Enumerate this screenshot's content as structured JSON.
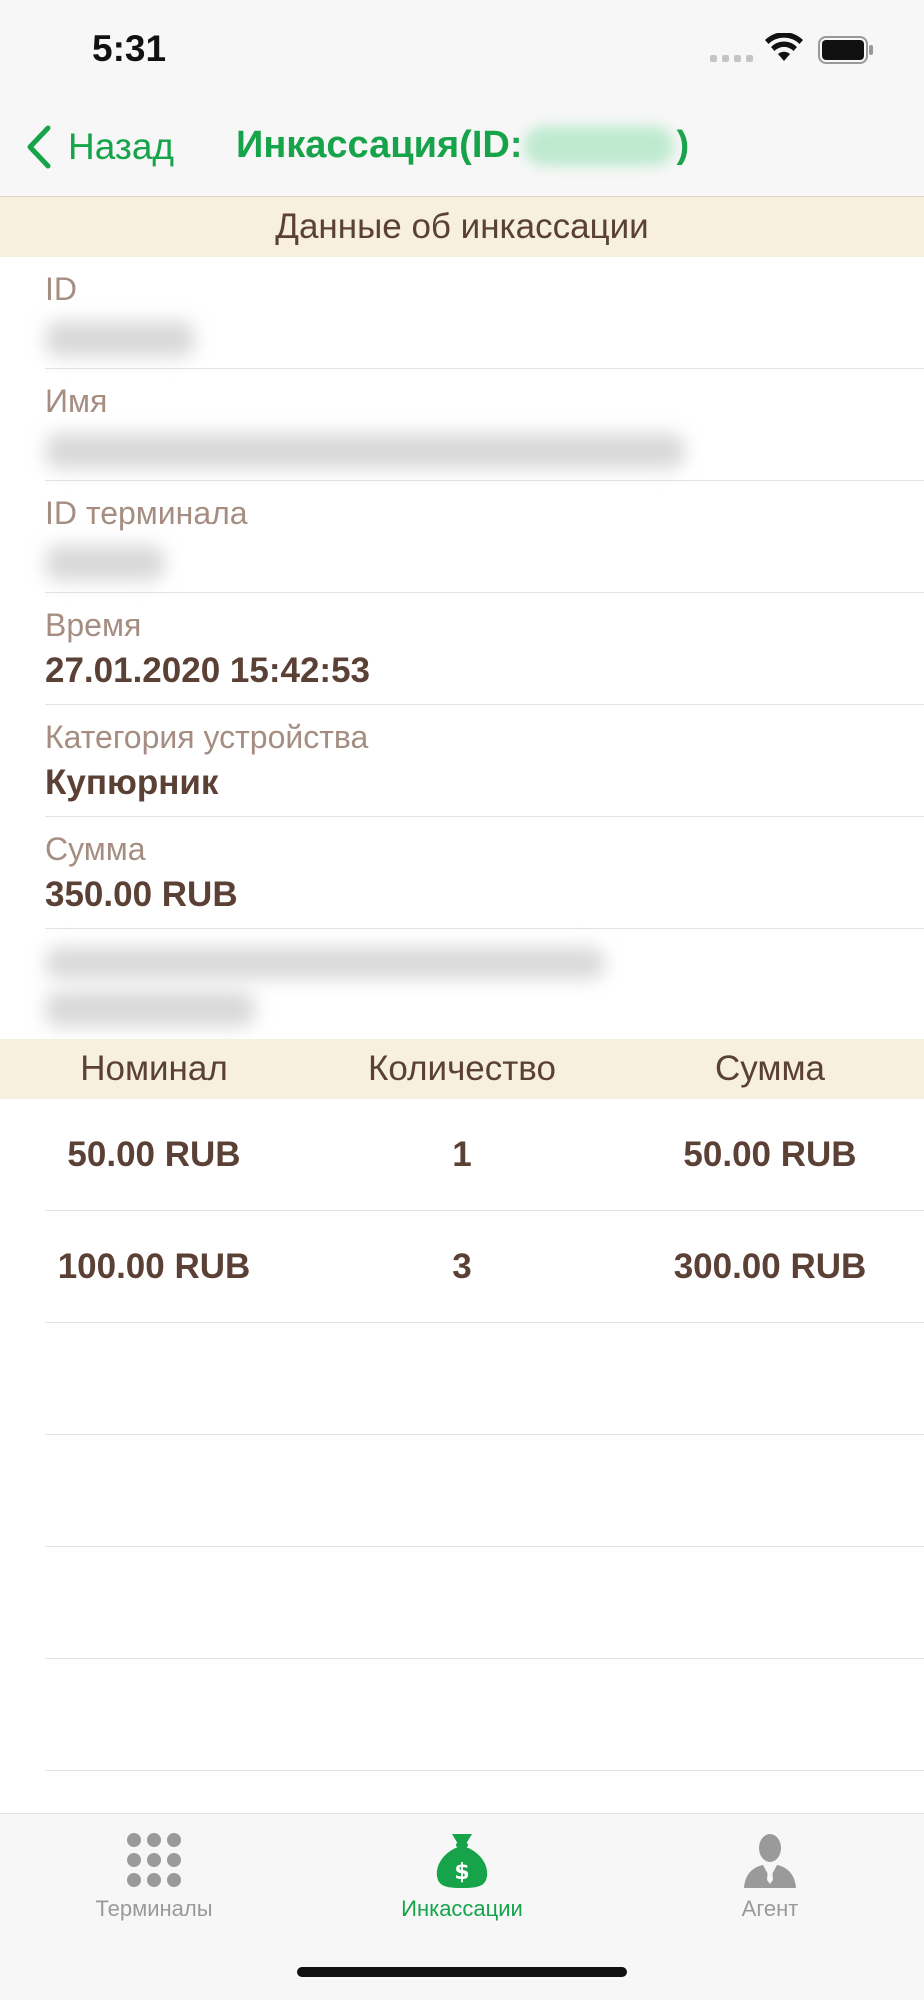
{
  "status_bar": {
    "time": "5:31"
  },
  "nav": {
    "back_label": "Назад",
    "title_prefix": "Инкассация(ID:",
    "title_suffix": ")"
  },
  "details_header": "Данные об инкассации",
  "details": [
    {
      "label": "ID",
      "value": ""
    },
    {
      "label": "Имя",
      "value": ""
    },
    {
      "label": "ID терминала",
      "value": ""
    },
    {
      "label": "Время",
      "value": "27.01.2020 15:42:53"
    },
    {
      "label": "Категория устройства",
      "value": "Купюрник"
    },
    {
      "label": "Сумма",
      "value": "350.00 RUB"
    }
  ],
  "table": {
    "headers": [
      "Номинал",
      "Количество",
      "Сумма"
    ],
    "rows": [
      {
        "nominal": "50.00 RUB",
        "count": "1",
        "sum": "50.00 RUB"
      },
      {
        "nominal": "100.00 RUB",
        "count": "3",
        "sum": "300.00 RUB"
      }
    ]
  },
  "tabs": [
    {
      "label": "Терминалы",
      "icon": "grid-icon",
      "active": false
    },
    {
      "label": "Инкассации",
      "icon": "money-bag-icon",
      "active": true
    },
    {
      "label": "Агент",
      "icon": "agent-icon",
      "active": false
    }
  ],
  "colors": {
    "accent": "#16a34a",
    "header_bg": "#f7f0de",
    "text": "#5a4035",
    "label": "#a58e81"
  }
}
